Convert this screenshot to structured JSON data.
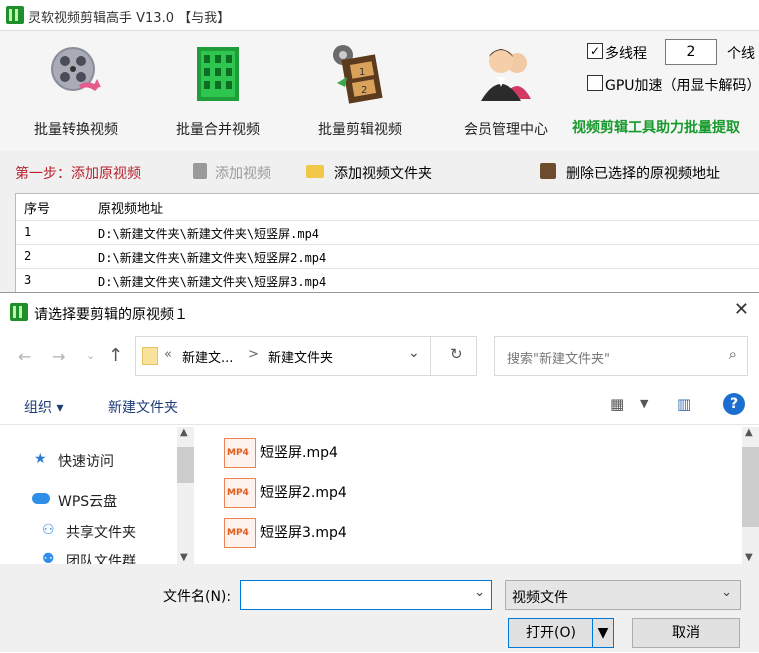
{
  "app": {
    "title": "灵软视频剪辑高手 V13.0 【与我】",
    "toolbar": [
      {
        "label": "批量转换视频",
        "icon": "film-reel-convert-icon"
      },
      {
        "label": "批量合并视频",
        "icon": "green-building-merge-icon"
      },
      {
        "label": "批量剪辑视频",
        "icon": "film-strip-cut-icon"
      },
      {
        "label": "会员管理中心",
        "icon": "users-icon"
      }
    ],
    "multithread": {
      "label": "多线程",
      "checked": true,
      "value": "2",
      "suffix": "个线"
    },
    "gpu": {
      "label": "GPU加速（用显卡解码）",
      "checked": false
    },
    "slogan": "视频剪辑工具助力批量提取",
    "step_label": "第一步：添加原视频",
    "add_video": "添加视频",
    "add_folder": "添加视频文件夹",
    "delete_selected": "删除已选择的原视频地址",
    "table": {
      "headers": [
        "序号",
        "原视频地址"
      ],
      "rows": [
        {
          "no": "1",
          "path": "D:\\新建文件夹\\新建文件夹\\短竖屏.mp4"
        },
        {
          "no": "2",
          "path": "D:\\新建文件夹\\新建文件夹\\短竖屏2.mp4"
        },
        {
          "no": "3",
          "path": "D:\\新建文件夹\\新建文件夹\\短竖屏3.mp4"
        }
      ]
    }
  },
  "dialog": {
    "title": "请选择要剪辑的原视频１",
    "breadcrumb": {
      "prefix": "«",
      "part1": "新建文...",
      "sep": ">",
      "part2": "新建文件夹"
    },
    "search_placeholder": "搜索\"新建文件夹\"",
    "organize": "组织 ▾",
    "new_folder": "新建文件夹",
    "nav_items": [
      {
        "label": "快速访问",
        "icon": "star-icon"
      },
      {
        "label": "WPS云盘",
        "icon": "cloud-icon"
      },
      {
        "label": "共享文件夹",
        "icon": "share-folder-icon"
      },
      {
        "label": "团队文件群",
        "icon": "team-icon"
      }
    ],
    "files": [
      {
        "name": "短竖屏.mp4",
        "badge": "MP4"
      },
      {
        "name": "短竖屏2.mp4",
        "badge": "MP4"
      },
      {
        "name": "短竖屏3.mp4",
        "badge": "MP4"
      }
    ],
    "filename_label": "文件名(N):",
    "filename_value": "",
    "filetype": "视频文件",
    "open": "打开(O)",
    "cancel": "取消"
  }
}
